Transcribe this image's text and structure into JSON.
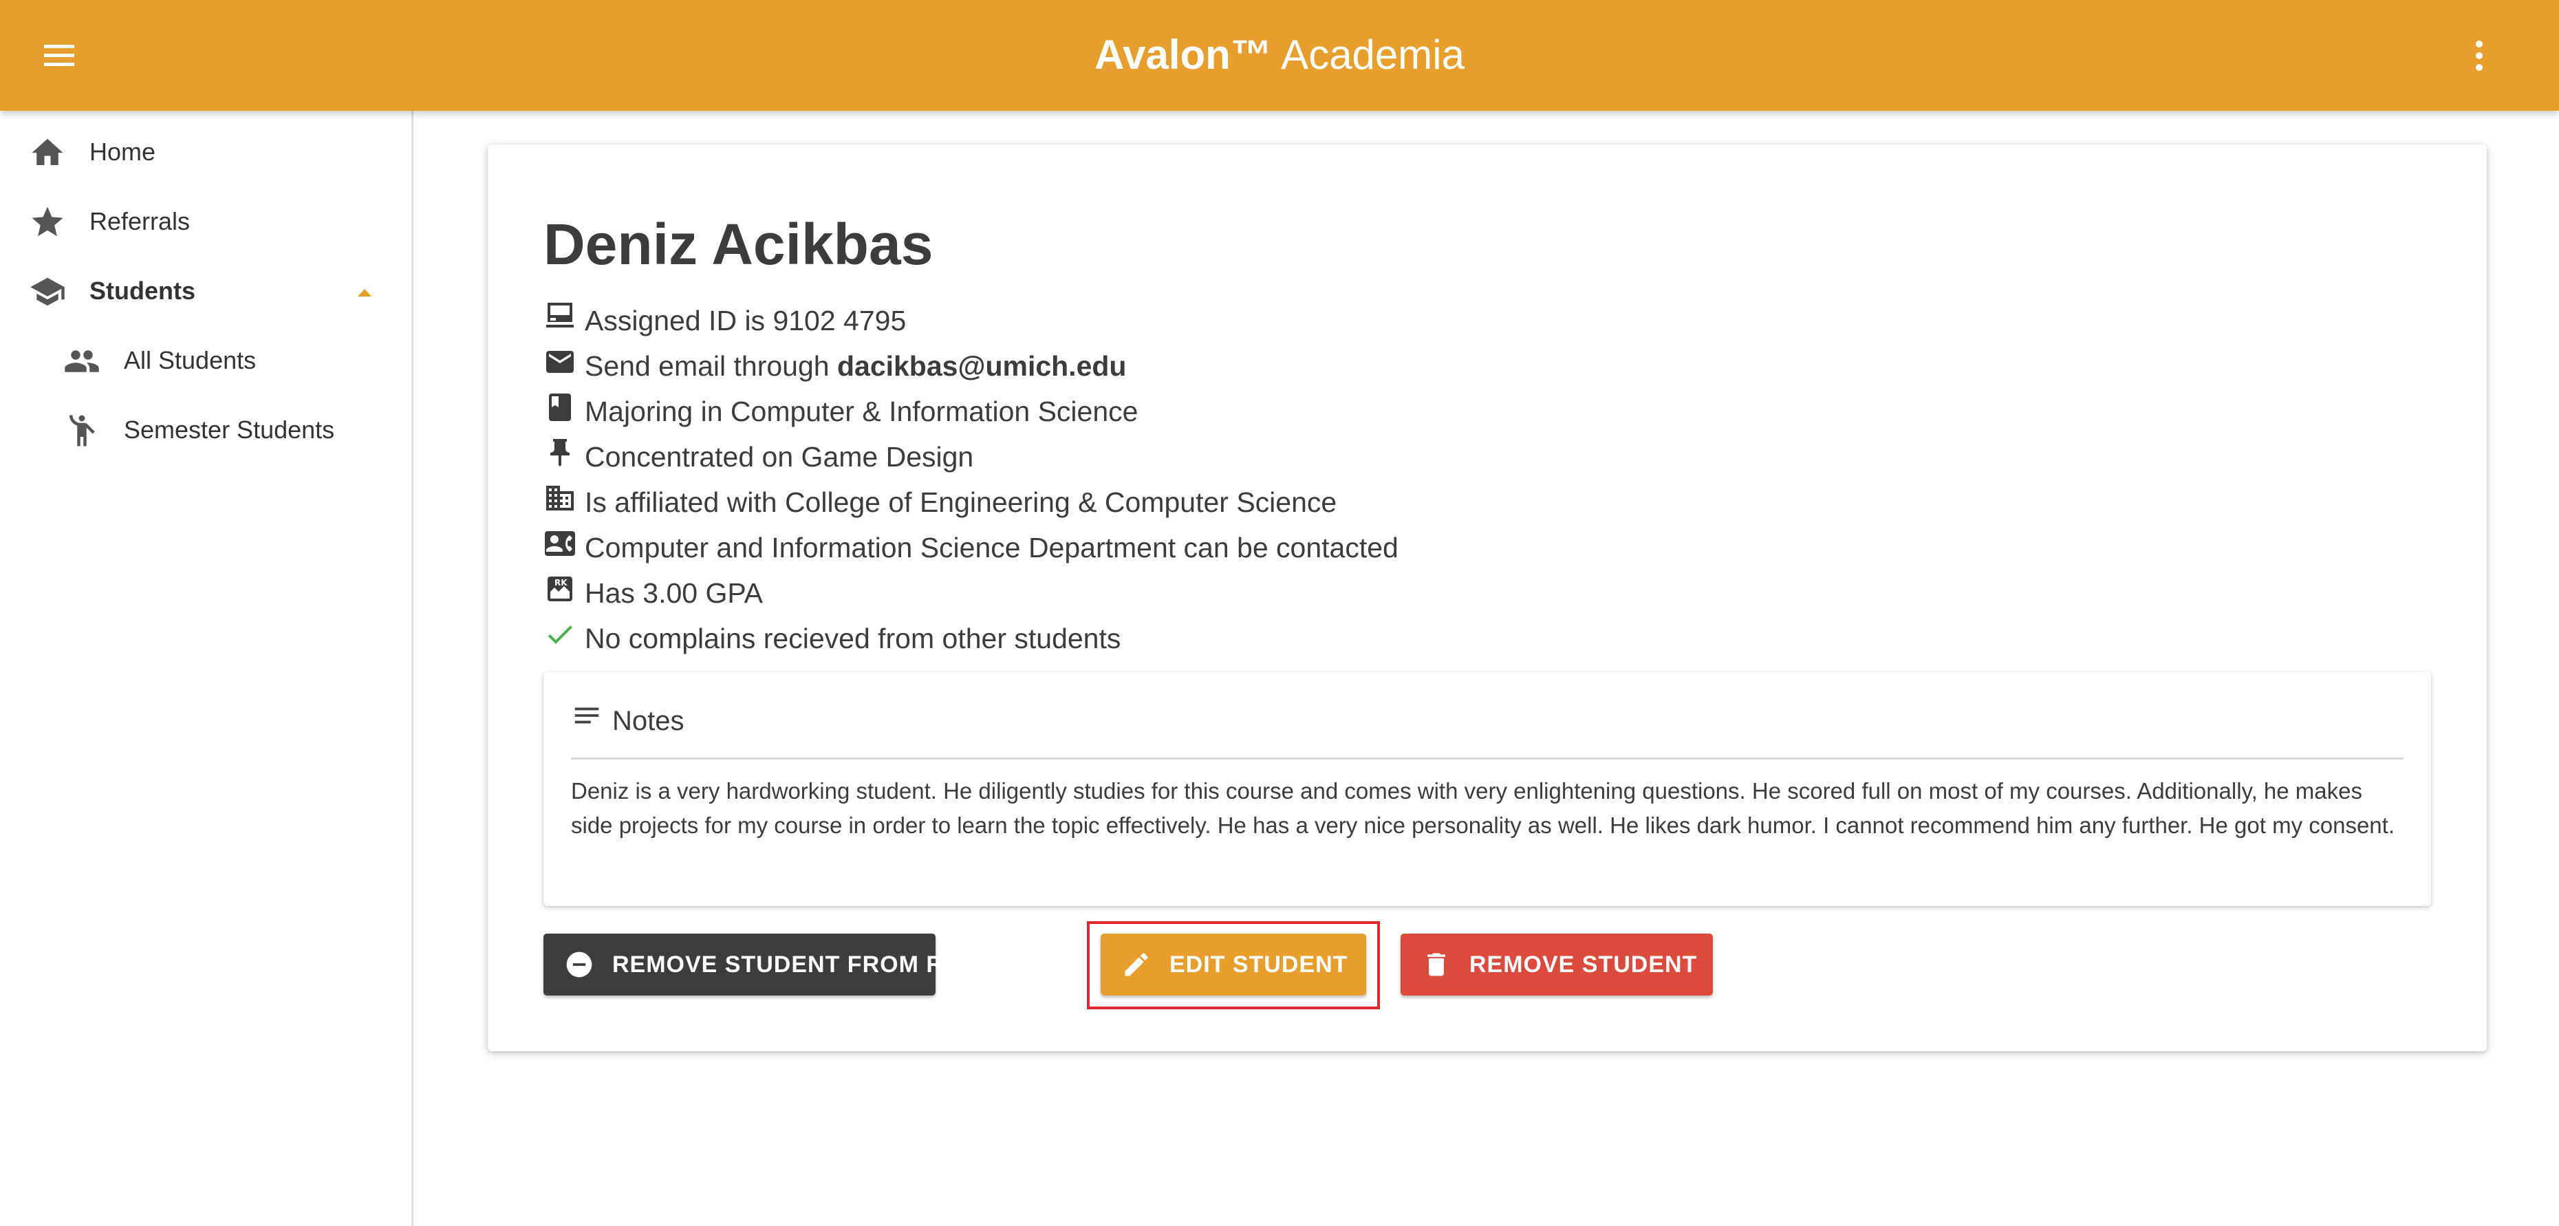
{
  "app": {
    "title_brand": "Avalon™",
    "title_rest": "Academia",
    "accent_color": "#E89E2C",
    "menu_icon": "menu-icon",
    "more_icon": "more-vertical-icon"
  },
  "sidebar": {
    "items": [
      {
        "label": "Home",
        "icon": "home-icon"
      },
      {
        "label": "Referrals",
        "icon": "star-icon"
      },
      {
        "label": "Students",
        "icon": "school-icon",
        "expanded": true
      },
      {
        "label": "All Students",
        "icon": "people-icon"
      },
      {
        "label": "Semester Students",
        "icon": "person-walking-icon"
      }
    ]
  },
  "student": {
    "name": "Deniz Acikbas",
    "info": [
      {
        "icon": "id-card-icon",
        "text": "Assigned ID is 9102 4795"
      },
      {
        "icon": "email-icon",
        "prefix": "Send email through ",
        "email": "dacikbas@umich.edu"
      },
      {
        "icon": "book-icon",
        "text": "Majoring in Computer & Information Science"
      },
      {
        "icon": "pin-icon",
        "text": "Concentrated on Game Design"
      },
      {
        "icon": "building-icon",
        "text": "Is affiliated with College of Engineering & Computer Science"
      },
      {
        "icon": "contact-card-icon",
        "text": "Computer and Information Science Department can be contacted"
      },
      {
        "icon": "grade-icon",
        "text": "Has 3.00 GPA"
      },
      {
        "icon": "check-icon",
        "text": "No complains recieved from other students",
        "color": "#4CAF50"
      }
    ],
    "notes": {
      "title": "Notes",
      "body": "Deniz is a very hardworking student. He diligently studies for this course and comes with very enlightening questions. He scored full on most of my courses. Additionally, he makes side projects for my course in order to learn the topic effectively. He has a very nice personality as well. He likes dark humor. I cannot recommend him any further. He got my consent."
    }
  },
  "actions": {
    "remove_referral": {
      "label": "REMOVE STUDENT FROM REFERRALS",
      "color": "#3D3D3D"
    },
    "edit": {
      "label": "EDIT STUDENT",
      "color": "#E89E2C"
    },
    "remove": {
      "label": "REMOVE STUDENT",
      "color": "#DB4A3A"
    }
  }
}
